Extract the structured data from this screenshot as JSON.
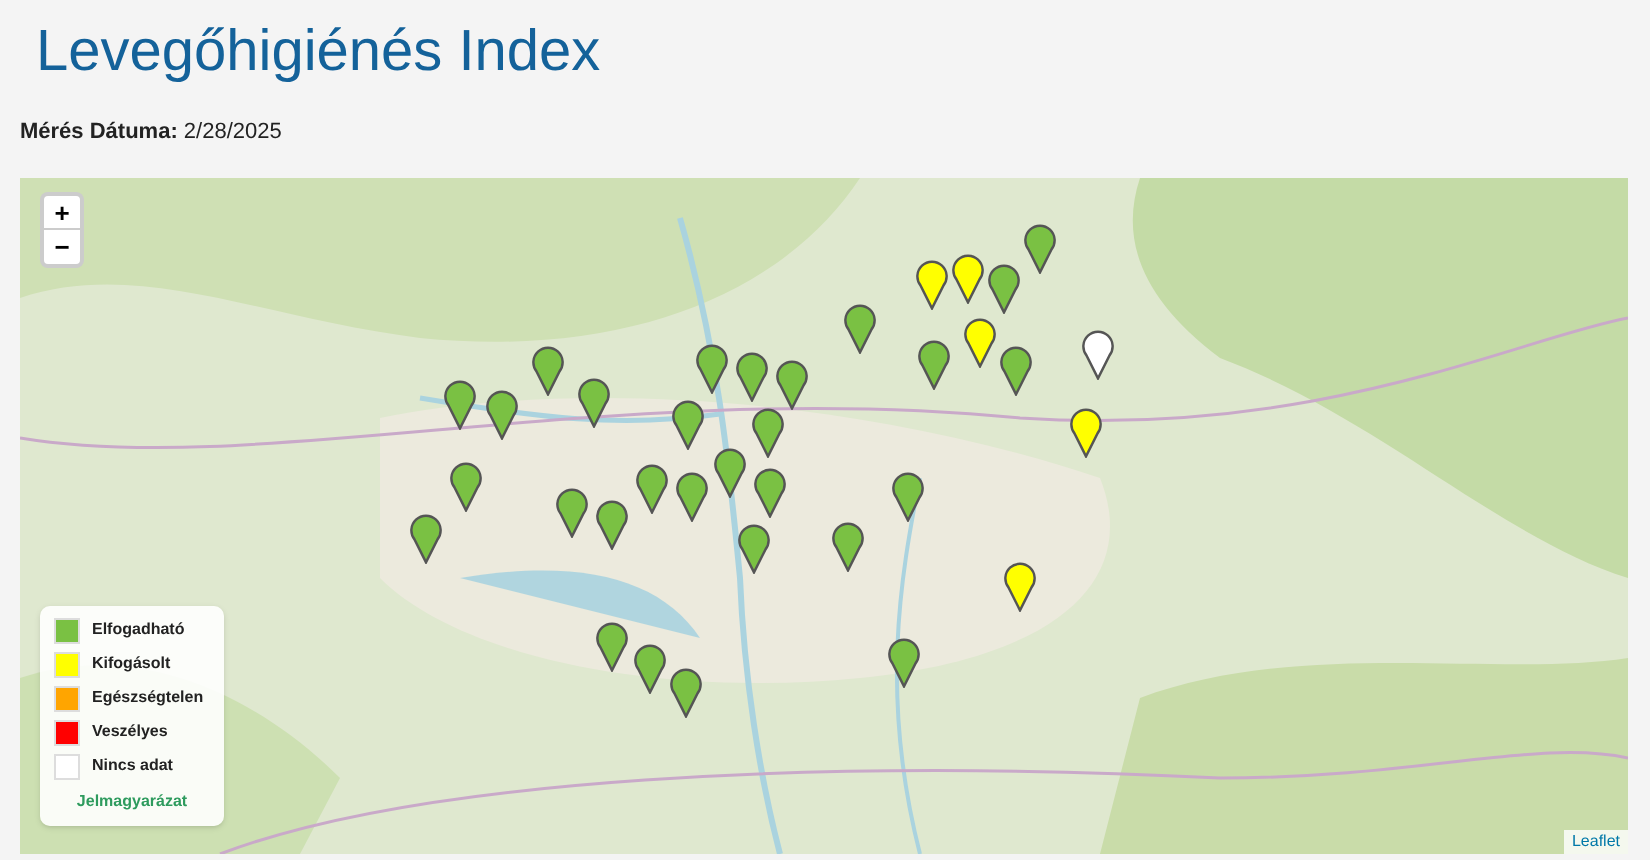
{
  "title": "Levegőhigiénés Index",
  "measurement": {
    "label": "Mérés Dátuma:",
    "value": "2/28/2025"
  },
  "map": {
    "zoom_in": "+",
    "zoom_out": "−",
    "attribution": "Leaflet",
    "markers": [
      {
        "color": "#7ac143"
      },
      {
        "color": "#7ac143"
      },
      {
        "color": "#7ac143"
      },
      {
        "color": "#7ac143"
      },
      {
        "color": "#7ac143"
      },
      {
        "color": "#7ac143"
      },
      {
        "color": "#7ac143"
      },
      {
        "color": "#7ac143"
      },
      {
        "color": "#7ac143"
      },
      {
        "color": "#7ac143"
      },
      {
        "color": "#7ac143"
      },
      {
        "color": "#7ac143"
      },
      {
        "color": "#7ac143"
      },
      {
        "color": "#7ac143"
      },
      {
        "color": "#7ac143"
      },
      {
        "color": "#7ac143"
      },
      {
        "color": "#7ac143"
      },
      {
        "color": "#7ac143"
      },
      {
        "color": "#7ac143"
      },
      {
        "color": "#7ac143"
      },
      {
        "color": "#7ac143"
      },
      {
        "color": "#7ac143"
      },
      {
        "color": "#7ac143"
      },
      {
        "color": "#7ac143"
      },
      {
        "color": "#7ac143"
      },
      {
        "color": "#7ac143"
      },
      {
        "color": "#7ac143"
      },
      {
        "color": "#7ac143"
      },
      {
        "color": "#7ac143"
      },
      {
        "color": "#ffff00"
      },
      {
        "color": "#ffff00"
      },
      {
        "color": "#ffff00"
      },
      {
        "color": "#ffff00"
      },
      {
        "color": "#ffff00"
      },
      {
        "color": "#ffffff"
      }
    ],
    "legend": {
      "items": [
        {
          "label": "Elfogadható",
          "color": "#7ac143"
        },
        {
          "label": "Kifogásolt",
          "color": "#ffff00"
        },
        {
          "label": "Egészségtelen",
          "color": "#ffa500"
        },
        {
          "label": "Veszélyes",
          "color": "#ff0000"
        },
        {
          "label": "Nincs adat",
          "color": "#ffffff"
        }
      ],
      "title": "Jelmagyarázat"
    }
  }
}
